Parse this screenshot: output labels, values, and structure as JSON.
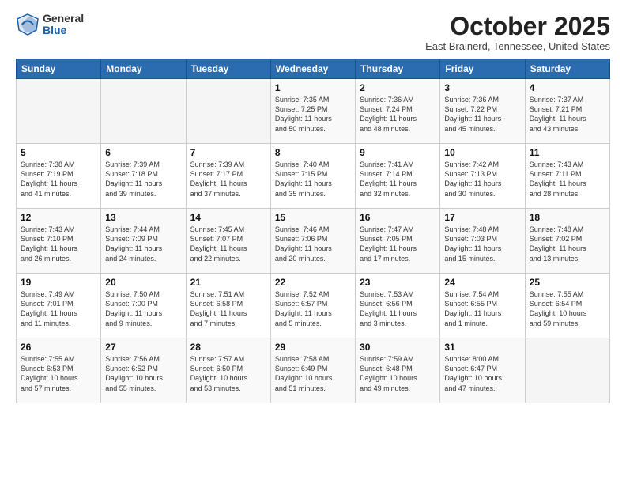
{
  "logo": {
    "general": "General",
    "blue": "Blue"
  },
  "title": "October 2025",
  "location": "East Brainerd, Tennessee, United States",
  "headers": [
    "Sunday",
    "Monday",
    "Tuesday",
    "Wednesday",
    "Thursday",
    "Friday",
    "Saturday"
  ],
  "weeks": [
    [
      {
        "day": "",
        "info": ""
      },
      {
        "day": "",
        "info": ""
      },
      {
        "day": "",
        "info": ""
      },
      {
        "day": "1",
        "info": "Sunrise: 7:35 AM\nSunset: 7:25 PM\nDaylight: 11 hours\nand 50 minutes."
      },
      {
        "day": "2",
        "info": "Sunrise: 7:36 AM\nSunset: 7:24 PM\nDaylight: 11 hours\nand 48 minutes."
      },
      {
        "day": "3",
        "info": "Sunrise: 7:36 AM\nSunset: 7:22 PM\nDaylight: 11 hours\nand 45 minutes."
      },
      {
        "day": "4",
        "info": "Sunrise: 7:37 AM\nSunset: 7:21 PM\nDaylight: 11 hours\nand 43 minutes."
      }
    ],
    [
      {
        "day": "5",
        "info": "Sunrise: 7:38 AM\nSunset: 7:19 PM\nDaylight: 11 hours\nand 41 minutes."
      },
      {
        "day": "6",
        "info": "Sunrise: 7:39 AM\nSunset: 7:18 PM\nDaylight: 11 hours\nand 39 minutes."
      },
      {
        "day": "7",
        "info": "Sunrise: 7:39 AM\nSunset: 7:17 PM\nDaylight: 11 hours\nand 37 minutes."
      },
      {
        "day": "8",
        "info": "Sunrise: 7:40 AM\nSunset: 7:15 PM\nDaylight: 11 hours\nand 35 minutes."
      },
      {
        "day": "9",
        "info": "Sunrise: 7:41 AM\nSunset: 7:14 PM\nDaylight: 11 hours\nand 32 minutes."
      },
      {
        "day": "10",
        "info": "Sunrise: 7:42 AM\nSunset: 7:13 PM\nDaylight: 11 hours\nand 30 minutes."
      },
      {
        "day": "11",
        "info": "Sunrise: 7:43 AM\nSunset: 7:11 PM\nDaylight: 11 hours\nand 28 minutes."
      }
    ],
    [
      {
        "day": "12",
        "info": "Sunrise: 7:43 AM\nSunset: 7:10 PM\nDaylight: 11 hours\nand 26 minutes."
      },
      {
        "day": "13",
        "info": "Sunrise: 7:44 AM\nSunset: 7:09 PM\nDaylight: 11 hours\nand 24 minutes."
      },
      {
        "day": "14",
        "info": "Sunrise: 7:45 AM\nSunset: 7:07 PM\nDaylight: 11 hours\nand 22 minutes."
      },
      {
        "day": "15",
        "info": "Sunrise: 7:46 AM\nSunset: 7:06 PM\nDaylight: 11 hours\nand 20 minutes."
      },
      {
        "day": "16",
        "info": "Sunrise: 7:47 AM\nSunset: 7:05 PM\nDaylight: 11 hours\nand 17 minutes."
      },
      {
        "day": "17",
        "info": "Sunrise: 7:48 AM\nSunset: 7:03 PM\nDaylight: 11 hours\nand 15 minutes."
      },
      {
        "day": "18",
        "info": "Sunrise: 7:48 AM\nSunset: 7:02 PM\nDaylight: 11 hours\nand 13 minutes."
      }
    ],
    [
      {
        "day": "19",
        "info": "Sunrise: 7:49 AM\nSunset: 7:01 PM\nDaylight: 11 hours\nand 11 minutes."
      },
      {
        "day": "20",
        "info": "Sunrise: 7:50 AM\nSunset: 7:00 PM\nDaylight: 11 hours\nand 9 minutes."
      },
      {
        "day": "21",
        "info": "Sunrise: 7:51 AM\nSunset: 6:58 PM\nDaylight: 11 hours\nand 7 minutes."
      },
      {
        "day": "22",
        "info": "Sunrise: 7:52 AM\nSunset: 6:57 PM\nDaylight: 11 hours\nand 5 minutes."
      },
      {
        "day": "23",
        "info": "Sunrise: 7:53 AM\nSunset: 6:56 PM\nDaylight: 11 hours\nand 3 minutes."
      },
      {
        "day": "24",
        "info": "Sunrise: 7:54 AM\nSunset: 6:55 PM\nDaylight: 11 hours\nand 1 minute."
      },
      {
        "day": "25",
        "info": "Sunrise: 7:55 AM\nSunset: 6:54 PM\nDaylight: 10 hours\nand 59 minutes."
      }
    ],
    [
      {
        "day": "26",
        "info": "Sunrise: 7:55 AM\nSunset: 6:53 PM\nDaylight: 10 hours\nand 57 minutes."
      },
      {
        "day": "27",
        "info": "Sunrise: 7:56 AM\nSunset: 6:52 PM\nDaylight: 10 hours\nand 55 minutes."
      },
      {
        "day": "28",
        "info": "Sunrise: 7:57 AM\nSunset: 6:50 PM\nDaylight: 10 hours\nand 53 minutes."
      },
      {
        "day": "29",
        "info": "Sunrise: 7:58 AM\nSunset: 6:49 PM\nDaylight: 10 hours\nand 51 minutes."
      },
      {
        "day": "30",
        "info": "Sunrise: 7:59 AM\nSunset: 6:48 PM\nDaylight: 10 hours\nand 49 minutes."
      },
      {
        "day": "31",
        "info": "Sunrise: 8:00 AM\nSunset: 6:47 PM\nDaylight: 10 hours\nand 47 minutes."
      },
      {
        "day": "",
        "info": ""
      }
    ]
  ]
}
